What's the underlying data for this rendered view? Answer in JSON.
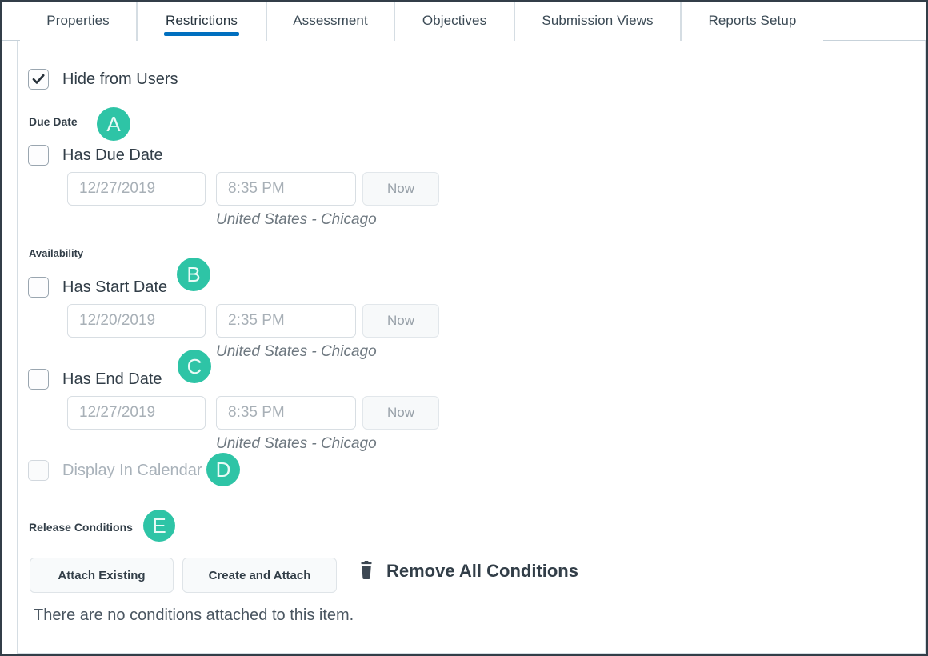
{
  "tabs": [
    {
      "label": "Properties",
      "active": false
    },
    {
      "label": "Restrictions",
      "active": true
    },
    {
      "label": "Assessment",
      "active": false
    },
    {
      "label": "Objectives",
      "active": false
    },
    {
      "label": "Submission Views",
      "active": false
    },
    {
      "label": "Reports Setup",
      "active": false
    }
  ],
  "colors": {
    "active_tab_underline": "#006FBF",
    "badge_teal": "#2EC4A6",
    "text_dark": "#323E48",
    "frame_border": "#323E48"
  },
  "hide_from_users": {
    "label": "Hide from Users",
    "checked": true
  },
  "due_date": {
    "section_label": "Due Date",
    "badge": "A",
    "checkbox_label": "Has Due Date",
    "checked": false,
    "date_placeholder": "12/27/2019",
    "time_placeholder": "8:35 PM",
    "now_label": "Now",
    "timezone": "United States - Chicago"
  },
  "availability": {
    "section_label": "Availability",
    "start": {
      "badge": "B",
      "checkbox_label": "Has Start Date",
      "checked": false,
      "date_placeholder": "12/20/2019",
      "time_placeholder": "2:35 PM",
      "now_label": "Now",
      "timezone": "United States - Chicago"
    },
    "end": {
      "badge": "C",
      "checkbox_label": "Has End Date",
      "checked": false,
      "date_placeholder": "12/27/2019",
      "time_placeholder": "8:35 PM",
      "now_label": "Now",
      "timezone": "United States - Chicago"
    },
    "display_in_calendar": {
      "badge": "D",
      "checkbox_label": "Display In Calendar",
      "checked": false,
      "disabled": true
    }
  },
  "release_conditions": {
    "section_label": "Release Conditions",
    "badge": "E",
    "attach_existing_label": "Attach Existing",
    "create_and_attach_label": "Create and Attach",
    "remove_all_label": "Remove All Conditions",
    "empty_message": "There are no conditions attached to this item."
  }
}
